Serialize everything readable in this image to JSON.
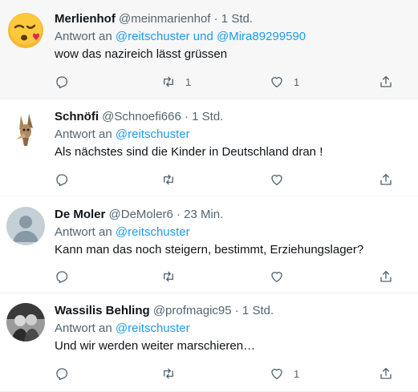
{
  "tweets": [
    {
      "name": "Merlienhof",
      "handle": "@meinmarienhof",
      "time": "· 1 Std.",
      "reply_prefix": "Antwort an ",
      "reply_to": "@reitschuster und @Mira89299590",
      "text": "wow das nazireich lässt grüssen",
      "avatar": "kiss-emoji-avatar",
      "retweets": "1",
      "likes": "1"
    },
    {
      "name": "Schnöfi",
      "handle": "@Schnoefi666",
      "time": "· 1 Std.",
      "reply_prefix": "Antwort an ",
      "reply_to": "@reitschuster",
      "text": "Als nächstes sind die Kinder in Deutschland dran !",
      "avatar": "coyote-avatar",
      "retweets": "",
      "likes": ""
    },
    {
      "name": "De Moler",
      "handle": "@DeMoler6",
      "time": "· 23 Min.",
      "reply_prefix": "Antwort an ",
      "reply_to": "@reitschuster",
      "text": "Kann man das noch steigern, bestimmt, Erziehungslager?",
      "avatar": "default-avatar",
      "retweets": "",
      "likes": ""
    },
    {
      "name": "Wassilis Behling",
      "handle": "@profmagic95",
      "time": "· 1 Std.",
      "reply_prefix": "Antwort an ",
      "reply_to": "@reitschuster",
      "text": "Und wir werden weiter marschieren…",
      "avatar": "photo-avatar",
      "retweets": "",
      "likes": "1"
    }
  ],
  "colors": {
    "link": "#1d9bf0",
    "secondary": "#536471",
    "text": "#0f1419",
    "highlight": "#f7f7f7"
  },
  "icons": [
    "reply-icon",
    "retweet-icon",
    "like-icon",
    "share-icon"
  ]
}
